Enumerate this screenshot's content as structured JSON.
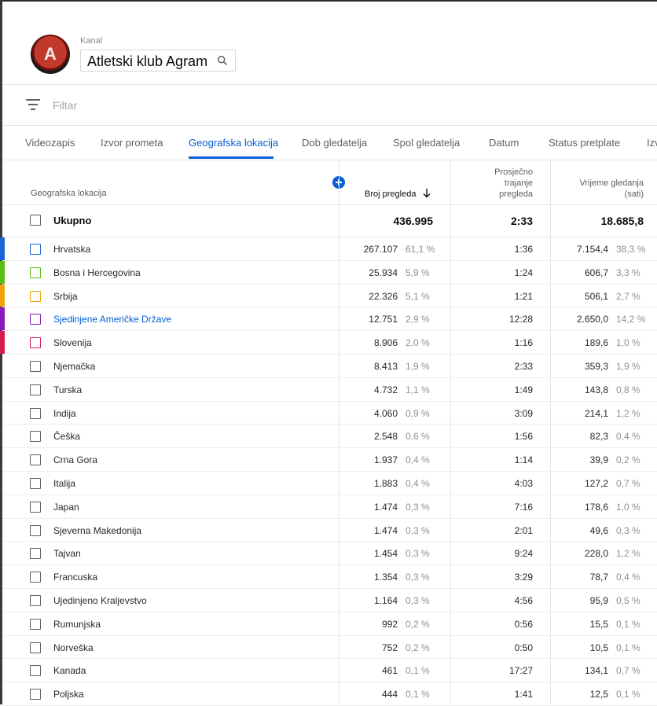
{
  "header": {
    "caption": "Kanal",
    "channel_name": "Atletski klub Agram"
  },
  "filter": {
    "placeholder": "Filtar"
  },
  "tabs": [
    {
      "label": "Videozapis",
      "active": false
    },
    {
      "label": "Izvor prometa",
      "active": false
    },
    {
      "label": "Geografska lokacija",
      "active": true
    },
    {
      "label": "Dob gledatelja",
      "active": false
    },
    {
      "label": "Spol gledatelja",
      "active": false
    },
    {
      "label": "Datum",
      "active": false
    },
    {
      "label": "Status pretplate",
      "active": false
    },
    {
      "label": "Izv",
      "active": false
    }
  ],
  "columns": {
    "location": "Geografska lokacija",
    "views": "Broj pregleda",
    "avg_duration": [
      "Prosječno",
      "trajanje",
      "pregleda"
    ],
    "watch_time": [
      "Vrijeme gledanja",
      "(sati)"
    ]
  },
  "total": {
    "label": "Ukupno",
    "views": "436.995",
    "avg_duration": "2:33",
    "watch_time": "18.685,8"
  },
  "rows": [
    {
      "country": "Hrvatska",
      "views": "267.107",
      "views_pct": "61,1 %",
      "avg": "1:36",
      "watch": "7.154,4",
      "watch_pct": "38,3 %",
      "color": "#1a66d9",
      "selected": true
    },
    {
      "country": "Bosna i Hercegovina",
      "views": "25.934",
      "views_pct": "5,9 %",
      "avg": "1:24",
      "watch": "606,7",
      "watch_pct": "3,3 %",
      "color": "#5bbd14",
      "selected": true
    },
    {
      "country": "Srbija",
      "views": "22.326",
      "views_pct": "5,1 %",
      "avg": "1:21",
      "watch": "506,1",
      "watch_pct": "2,7 %",
      "color": "#f0a30a",
      "selected": true
    },
    {
      "country": "Sjedinjene Američke Države",
      "views": "12.751",
      "views_pct": "2,9 %",
      "avg": "12:28",
      "watch": "2.650,0",
      "watch_pct": "14,2 %",
      "color": "#8a1ab8",
      "selected": true,
      "link": true
    },
    {
      "country": "Slovenija",
      "views": "8.906",
      "views_pct": "2,0 %",
      "avg": "1:16",
      "watch": "189,6",
      "watch_pct": "1,0 %",
      "color": "#d61c4e",
      "selected": true
    },
    {
      "country": "Njemačka",
      "views": "8.413",
      "views_pct": "1,9 %",
      "avg": "2:33",
      "watch": "359,3",
      "watch_pct": "1,9 %"
    },
    {
      "country": "Turska",
      "views": "4.732",
      "views_pct": "1,1 %",
      "avg": "1:49",
      "watch": "143,8",
      "watch_pct": "0,8 %"
    },
    {
      "country": "Indija",
      "views": "4.060",
      "views_pct": "0,9 %",
      "avg": "3:09",
      "watch": "214,1",
      "watch_pct": "1,2 %"
    },
    {
      "country": "Češka",
      "views": "2.548",
      "views_pct": "0,6 %",
      "avg": "1:56",
      "watch": "82,3",
      "watch_pct": "0,4 %"
    },
    {
      "country": "Crna Gora",
      "views": "1.937",
      "views_pct": "0,4 %",
      "avg": "1:14",
      "watch": "39,9",
      "watch_pct": "0,2 %"
    },
    {
      "country": "Italija",
      "views": "1.883",
      "views_pct": "0,4 %",
      "avg": "4:03",
      "watch": "127,2",
      "watch_pct": "0,7 %"
    },
    {
      "country": "Japan",
      "views": "1.474",
      "views_pct": "0,3 %",
      "avg": "7:16",
      "watch": "178,6",
      "watch_pct": "1,0 %"
    },
    {
      "country": "Sjeverna Makedonija",
      "views": "1.474",
      "views_pct": "0,3 %",
      "avg": "2:01",
      "watch": "49,6",
      "watch_pct": "0,3 %"
    },
    {
      "country": "Tajvan",
      "views": "1.454",
      "views_pct": "0,3 %",
      "avg": "9:24",
      "watch": "228,0",
      "watch_pct": "1,2 %"
    },
    {
      "country": "Francuska",
      "views": "1.354",
      "views_pct": "0,3 %",
      "avg": "3:29",
      "watch": "78,7",
      "watch_pct": "0,4 %"
    },
    {
      "country": "Ujedinjeno Kraljevstvo",
      "views": "1.164",
      "views_pct": "0,3 %",
      "avg": "4:56",
      "watch": "95,9",
      "watch_pct": "0,5 %"
    },
    {
      "country": "Rumunjska",
      "views": "992",
      "views_pct": "0,2 %",
      "avg": "0:56",
      "watch": "15,5",
      "watch_pct": "0,1 %"
    },
    {
      "country": "Norveška",
      "views": "752",
      "views_pct": "0,2 %",
      "avg": "0:50",
      "watch": "10,5",
      "watch_pct": "0,1 %"
    },
    {
      "country": "Kanada",
      "views": "461",
      "views_pct": "0,1 %",
      "avg": "17:27",
      "watch": "134,1",
      "watch_pct": "0,7 %"
    },
    {
      "country": "Poljska",
      "views": "444",
      "views_pct": "0,1 %",
      "avg": "1:41",
      "watch": "12,5",
      "watch_pct": "0,1 %"
    }
  ]
}
